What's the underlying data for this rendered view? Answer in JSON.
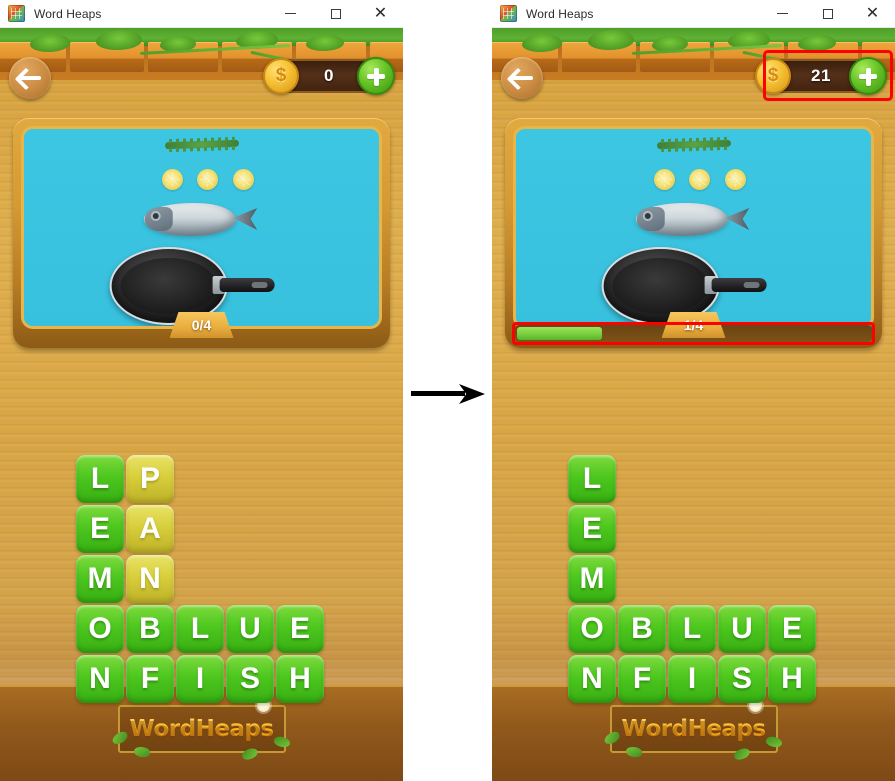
{
  "window": {
    "title": "Word Heaps",
    "icon": "app-tiles-icon",
    "controls": {
      "minimize": "—",
      "maximize": "□",
      "close": "✕"
    }
  },
  "panels": [
    {
      "id": "before",
      "back_button": "back-arrow-icon",
      "coins": {
        "value": "0",
        "coin_icon": "$",
        "add_label": "+",
        "highlighted": false
      },
      "puzzle": {
        "progress_label": "0/4",
        "progress_percent": 0,
        "show_progress_bar": false,
        "scene_items": [
          "herb-sprig",
          "lemon-slice",
          "lemon-slice",
          "lemon-slice",
          "fish",
          "frying-pan"
        ]
      },
      "tiles": [
        [
          {
            "letter": "L",
            "color": "green"
          },
          {
            "letter": "P",
            "color": "olive"
          },
          {
            "letter": "",
            "color": "empty"
          },
          {
            "letter": "",
            "color": "empty"
          },
          {
            "letter": "",
            "color": "empty"
          }
        ],
        [
          {
            "letter": "E",
            "color": "green"
          },
          {
            "letter": "A",
            "color": "olive"
          },
          {
            "letter": "",
            "color": "empty"
          },
          {
            "letter": "",
            "color": "empty"
          },
          {
            "letter": "",
            "color": "empty"
          }
        ],
        [
          {
            "letter": "M",
            "color": "green"
          },
          {
            "letter": "N",
            "color": "olive"
          },
          {
            "letter": "",
            "color": "empty"
          },
          {
            "letter": "",
            "color": "empty"
          },
          {
            "letter": "",
            "color": "empty"
          }
        ],
        [
          {
            "letter": "O",
            "color": "green"
          },
          {
            "letter": "B",
            "color": "green"
          },
          {
            "letter": "L",
            "color": "green"
          },
          {
            "letter": "U",
            "color": "green"
          },
          {
            "letter": "E",
            "color": "green"
          }
        ],
        [
          {
            "letter": "N",
            "color": "green"
          },
          {
            "letter": "F",
            "color": "green"
          },
          {
            "letter": "I",
            "color": "green"
          },
          {
            "letter": "S",
            "color": "green"
          },
          {
            "letter": "H",
            "color": "green"
          }
        ]
      ],
      "logo": "WordHeaps"
    },
    {
      "id": "after",
      "back_button": "back-arrow-icon",
      "coins": {
        "value": "21",
        "coin_icon": "$",
        "add_label": "+",
        "highlighted": true
      },
      "puzzle": {
        "progress_label": "1/4",
        "progress_percent": 25,
        "show_progress_bar": true,
        "scene_items": [
          "herb-sprig",
          "lemon-slice",
          "lemon-slice",
          "lemon-slice",
          "fish",
          "frying-pan"
        ]
      },
      "tiles": [
        [
          {
            "letter": "L",
            "color": "green"
          },
          {
            "letter": "",
            "color": "empty"
          },
          {
            "letter": "",
            "color": "empty"
          },
          {
            "letter": "",
            "color": "empty"
          },
          {
            "letter": "",
            "color": "empty"
          }
        ],
        [
          {
            "letter": "E",
            "color": "green"
          },
          {
            "letter": "",
            "color": "empty"
          },
          {
            "letter": "",
            "color": "empty"
          },
          {
            "letter": "",
            "color": "empty"
          },
          {
            "letter": "",
            "color": "empty"
          }
        ],
        [
          {
            "letter": "M",
            "color": "green"
          },
          {
            "letter": "",
            "color": "empty"
          },
          {
            "letter": "",
            "color": "empty"
          },
          {
            "letter": "",
            "color": "empty"
          },
          {
            "letter": "",
            "color": "empty"
          }
        ],
        [
          {
            "letter": "O",
            "color": "green"
          },
          {
            "letter": "B",
            "color": "green"
          },
          {
            "letter": "L",
            "color": "green"
          },
          {
            "letter": "U",
            "color": "green"
          },
          {
            "letter": "E",
            "color": "green"
          }
        ],
        [
          {
            "letter": "N",
            "color": "green"
          },
          {
            "letter": "F",
            "color": "green"
          },
          {
            "letter": "I",
            "color": "green"
          },
          {
            "letter": "S",
            "color": "green"
          },
          {
            "letter": "H",
            "color": "green"
          }
        ]
      ],
      "logo": "WordHeaps"
    }
  ],
  "divider": {
    "arrow": "right-arrow-icon"
  },
  "colors": {
    "highlight": "#ff0000",
    "tile_green": "#4ec71f",
    "tile_olive": "#d8cf3c",
    "coin_gold": "#f5c032",
    "progress_green": "#74cc38",
    "wood": "#d9a544",
    "photo_bg": "#3cc6e2"
  }
}
